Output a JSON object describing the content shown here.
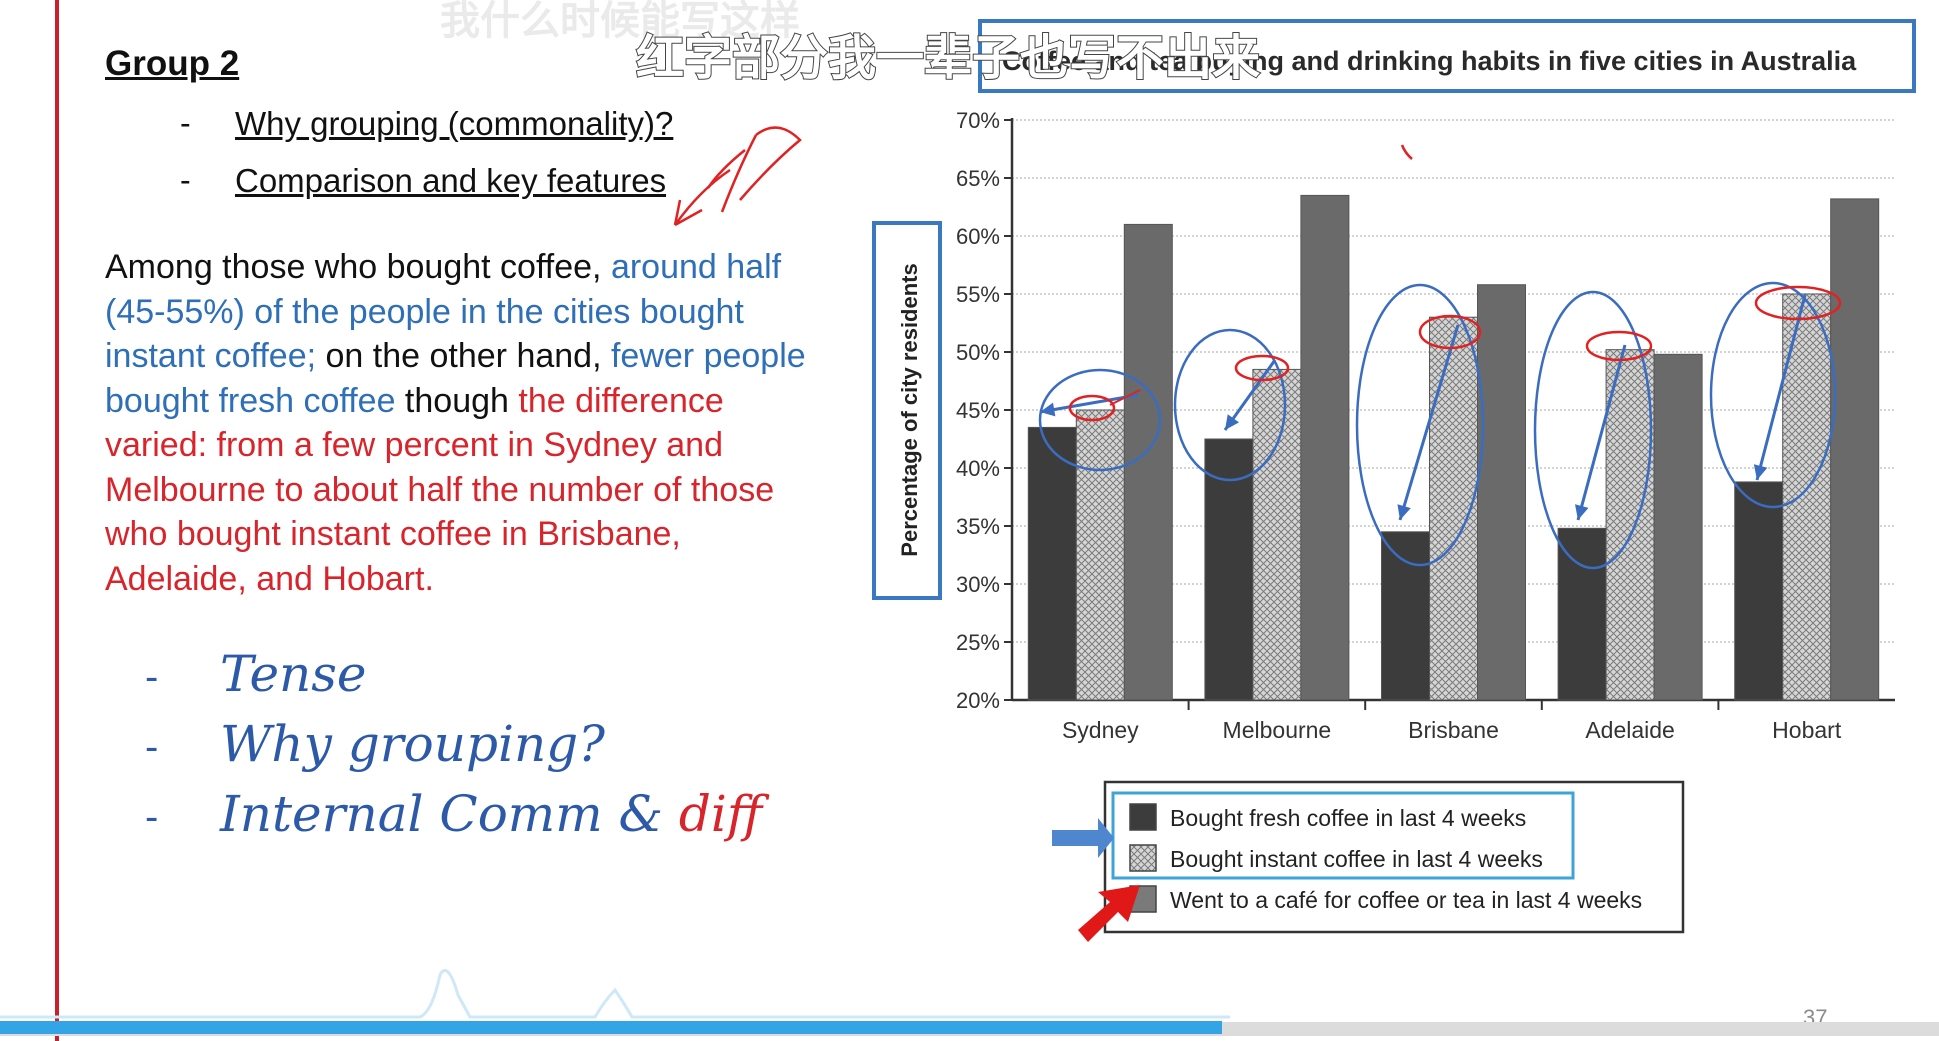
{
  "slide": {
    "group_title": "Group 2",
    "bullets": [
      {
        "dash": "-",
        "text": "Why grouping (commonality)?"
      },
      {
        "dash": "-",
        "text": "Comparison and key features"
      }
    ],
    "paragraph": {
      "seg1": "Among those who bought coffee, ",
      "seg2": "around half (45-55%) of the people in the cities bought instant coffee;",
      "seg3": " on the other hand, ",
      "seg4": "fewer people bought fresh coffee",
      "seg5": " though ",
      "seg6": "the difference varied: from a few percent in Sydney and Melbourne to about half the number of those who bought instant coffee in Brisbane, Adelaide, and Hobart."
    },
    "handwritten": [
      {
        "dash": "-",
        "text": "Tense"
      },
      {
        "dash": "-",
        "text": "Why grouping?"
      },
      {
        "dash": "-",
        "text": "Internal Comm & ",
        "accent": "diff"
      }
    ],
    "page_number": "37"
  },
  "subtitles": {
    "line1": "我什么时候能写这样",
    "line2": "红字部分我一辈子也写不出来"
  },
  "video": {
    "progress_fraction": 0.63
  },
  "colors": {
    "accent_blue": "#2e6fb7",
    "accent_red": "#d8242b",
    "fresh": "#3c3c3c",
    "instant": "#c8c8c8",
    "cafe": "#6a6a6a",
    "annotation_blue": "#3a6cc0",
    "annotation_red": "#e02222"
  },
  "chart_data": {
    "type": "bar",
    "title": "Coffee and tea buying and drinking habits in five cities in Australia",
    "ylabel": "Percentage of city residents",
    "xlabel": "",
    "ylim": [
      20,
      70
    ],
    "yticks": [
      "20%",
      "25%",
      "30%",
      "35%",
      "40%",
      "45%",
      "50%",
      "55%",
      "60%",
      "65%",
      "70%"
    ],
    "categories": [
      "Sydney",
      "Melbourne",
      "Brisbane",
      "Adelaide",
      "Hobart"
    ],
    "series": [
      {
        "name": "Bought fresh coffee in last 4 weeks",
        "values": [
          43.5,
          42.5,
          34.5,
          34.8,
          38.8
        ]
      },
      {
        "name": "Bought instant coffee in last 4 weeks",
        "values": [
          45.0,
          48.5,
          53.0,
          50.2,
          55.0
        ]
      },
      {
        "name": "Went to a café for coffee or tea in last 4 weeks",
        "values": [
          61.0,
          63.5,
          55.8,
          49.8,
          63.2
        ]
      }
    ],
    "grid": true,
    "legend_position": "bottom"
  }
}
